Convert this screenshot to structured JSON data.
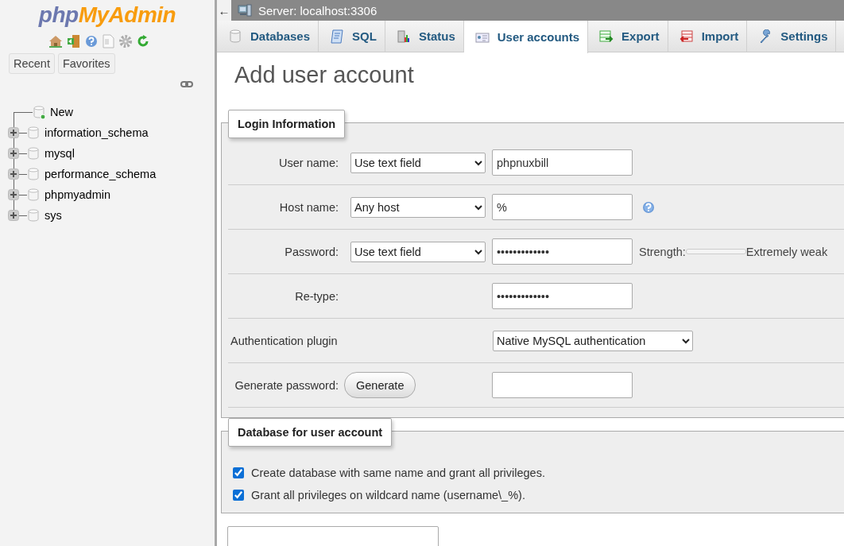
{
  "sidebar": {
    "logo": [
      "php",
      "MyAdmin"
    ],
    "buttons": [
      "Recent",
      "Favorites"
    ],
    "tree": [
      {
        "label": "New",
        "kind": "new"
      },
      {
        "label": "information_schema",
        "kind": "database",
        "expanded": false
      },
      {
        "label": "mysql",
        "kind": "database",
        "expanded": false
      },
      {
        "label": "performance_schema",
        "kind": "database",
        "expanded": false
      },
      {
        "label": "phpmyadmin",
        "kind": "database",
        "expanded": false
      },
      {
        "label": "sys",
        "kind": "database",
        "expanded": false
      }
    ]
  },
  "breadcrumb": {
    "back": "←",
    "server": "Server: localhost:3306"
  },
  "tabs": [
    {
      "label": "Databases",
      "selected": false
    },
    {
      "label": "SQL",
      "selected": false
    },
    {
      "label": "Status",
      "selected": false
    },
    {
      "label": "User accounts",
      "selected": true
    },
    {
      "label": "Export",
      "selected": false
    },
    {
      "label": "Import",
      "selected": false
    },
    {
      "label": "Settings",
      "selected": false
    }
  ],
  "page_title": "Add user account",
  "login_information": {
    "legend": "Login Information",
    "rows": [
      {
        "kind": "select-input",
        "label": "User name:",
        "select": "Use text field",
        "value": "phpnuxbill"
      },
      {
        "kind": "select-input",
        "label": "Host name:",
        "select": "Any host",
        "value": "%",
        "help": true
      },
      {
        "kind": "select-input",
        "label": "Password:",
        "select": "Use text field",
        "value": "•••••••••••••",
        "strength": {
          "label": "Strength:",
          "level": 0,
          "text": "Extremely weak"
        }
      },
      {
        "kind": "input",
        "label": "Re-type:",
        "value": "•••••••••••••"
      },
      {
        "kind": "plugin",
        "label": "Authentication plugin",
        "select": "Native MySQL authentication"
      },
      {
        "kind": "generate",
        "label": "Generate password:",
        "button": "Generate"
      }
    ]
  },
  "database_for_user_account": {
    "legend": "Database for user account",
    "options": [
      {
        "label": "Create database with same name and grant all privileges.",
        "checked": true
      },
      {
        "label": "Grant all privileges on wildcard name (username\\_%).",
        "checked": true
      }
    ]
  }
}
